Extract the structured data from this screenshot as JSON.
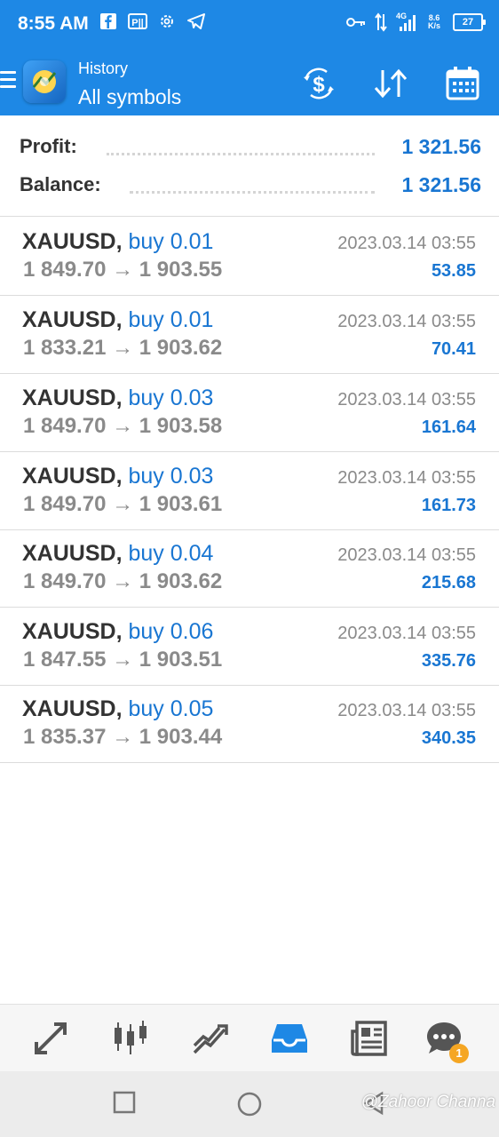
{
  "status_bar": {
    "time": "8:55 AM",
    "network": "4G",
    "speed_value": "8.6",
    "speed_unit": "K/s",
    "battery": "27"
  },
  "app_bar": {
    "subtitle": "History",
    "title": "All symbols",
    "icons": [
      "menu-icon",
      "app-logo",
      "currency-exchange-icon",
      "sort-icon",
      "calendar-icon"
    ]
  },
  "summary": {
    "profit_label": "Profit:",
    "profit_value": "1 321.56",
    "balance_label": "Balance:",
    "balance_value": "1 321.56"
  },
  "deals": [
    {
      "symbol": "XAUUSD,",
      "side": "buy 0.01",
      "open": "1 849.70",
      "close": "1 903.55",
      "date": "2023.03.14 03:55",
      "profit": "53.85"
    },
    {
      "symbol": "XAUUSD,",
      "side": "buy 0.01",
      "open": "1 833.21",
      "close": "1 903.62",
      "date": "2023.03.14 03:55",
      "profit": "70.41"
    },
    {
      "symbol": "XAUUSD,",
      "side": "buy 0.03",
      "open": "1 849.70",
      "close": "1 903.58",
      "date": "2023.03.14 03:55",
      "profit": "161.64"
    },
    {
      "symbol": "XAUUSD,",
      "side": "buy 0.03",
      "open": "1 849.70",
      "close": "1 903.61",
      "date": "2023.03.14 03:55",
      "profit": "161.73"
    },
    {
      "symbol": "XAUUSD,",
      "side": "buy 0.04",
      "open": "1 849.70",
      "close": "1 903.62",
      "date": "2023.03.14 03:55",
      "profit": "215.68"
    },
    {
      "symbol": "XAUUSD,",
      "side": "buy 0.06",
      "open": "1 847.55",
      "close": "1 903.51",
      "date": "2023.03.14 03:55",
      "profit": "335.76"
    },
    {
      "symbol": "XAUUSD,",
      "side": "buy 0.05",
      "open": "1 835.37",
      "close": "1 903.44",
      "date": "2023.03.14 03:55",
      "profit": "340.35"
    }
  ],
  "price_arrow": "→",
  "bottom_nav": {
    "items": [
      "quotes-icon",
      "chart-icon",
      "trade-icon",
      "history-icon",
      "news-icon",
      "chat-icon"
    ],
    "active": "history-icon",
    "chat_badge": "1"
  },
  "watermark": "@Zahoor Channa",
  "colors": {
    "primary": "#1e88e5",
    "profit": "#1976d2",
    "muted": "#8a8a8a",
    "badge": "#f5a623"
  }
}
